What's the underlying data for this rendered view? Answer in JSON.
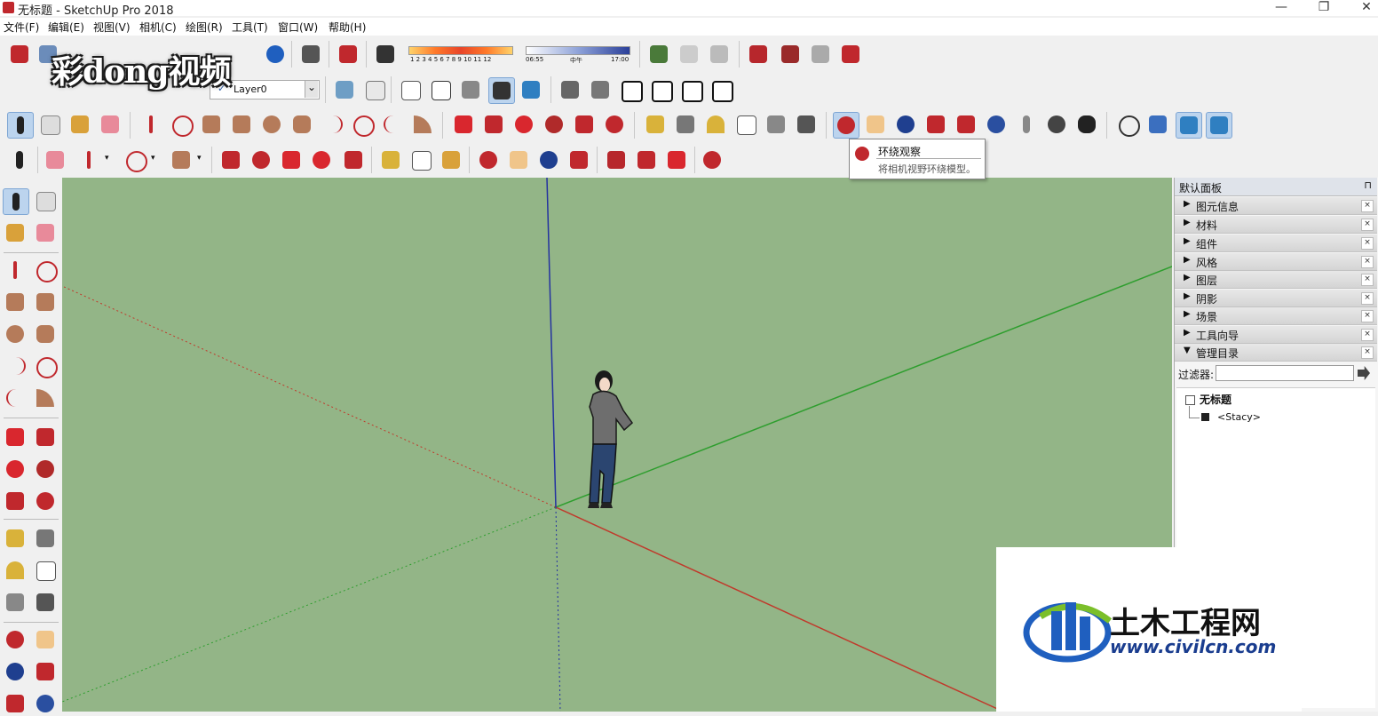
{
  "window": {
    "title": "无标题 - SketchUp Pro 2018",
    "minimize_glyph": "—",
    "restore_glyph": "❐",
    "close_glyph": "✕"
  },
  "menu": [
    "文件(F)",
    "编辑(E)",
    "视图(V)",
    "相机(C)",
    "绘图(R)",
    "工具(T)",
    "窗口(W)",
    "帮助(H)"
  ],
  "layers": {
    "current": "Layer0",
    "check_glyph": "✓",
    "dropdown_glyph": "⌄"
  },
  "shadow_toolbar": {
    "month_labels": "1 2 3 4 5 6 7 8 9 10 11 12",
    "time_start": "06:55",
    "time_mid": "中午",
    "time_end": "17:00"
  },
  "tooltip": {
    "title": "环绕观察",
    "description": "将相机视野环绕模型。"
  },
  "panel": {
    "title": "默认面板",
    "pin_glyph": "⊓",
    "sections": [
      {
        "label": "图元信息",
        "arrow": "▶"
      },
      {
        "label": "材料",
        "arrow": "▶"
      },
      {
        "label": "组件",
        "arrow": "▶"
      },
      {
        "label": "风格",
        "arrow": "▶"
      },
      {
        "label": "图层",
        "arrow": "▶"
      },
      {
        "label": "阴影",
        "arrow": "▶"
      },
      {
        "label": "场景",
        "arrow": "▶"
      },
      {
        "label": "工具向导",
        "arrow": "▶"
      },
      {
        "label": "管理目录",
        "arrow": "▼"
      }
    ],
    "close_glyph": "×",
    "outliner": {
      "filter_label": "过滤器:",
      "filter_value": "",
      "root": "无标题",
      "child": "<Stacy>"
    }
  },
  "watermarks": {
    "caidong": "彩dong视频",
    "civil_cn": "土木工程网",
    "civil_url": "www.civilcn.com"
  },
  "colors": {
    "viewport_bg": "#93b587",
    "axis_red": "#c0392b",
    "axis_green": "#2e9e2e",
    "axis_blue": "#2432a0"
  }
}
